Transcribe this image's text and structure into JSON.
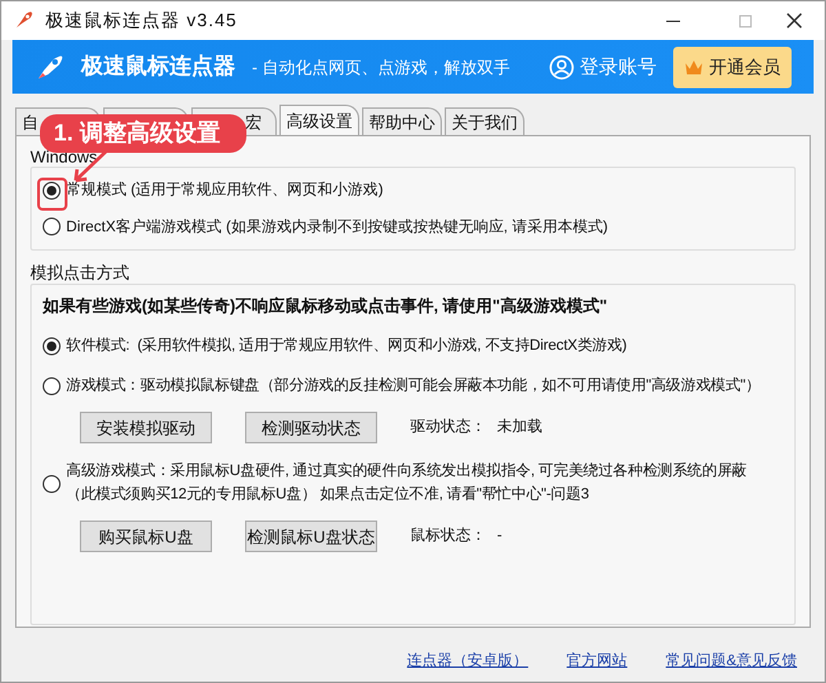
{
  "window": {
    "title": "极速鼠标连点器 v3.45"
  },
  "header": {
    "app_name": "极速鼠标连点器",
    "slogan": "- 自动化点网页、点游戏，解放双手",
    "login": "登录账号",
    "vip_button": "开通会员"
  },
  "tabs": [
    {
      "label": "自",
      "selected": false
    },
    {
      "selected": false
    },
    {
      "label": "宏",
      "selected": false
    },
    {
      "label": "高级设置",
      "selected": true
    },
    {
      "label": "帮助中心",
      "selected": false
    },
    {
      "label": "关于我们",
      "selected": false
    }
  ],
  "callout": {
    "text": "1. 调整高级设置"
  },
  "listen_group": {
    "title": "Windows",
    "options": [
      {
        "label": "常规模式 (适用于常规应用软件、网页和小游戏)",
        "selected": true
      },
      {
        "label": "DirectX客户端游戏模式 (如果游戏内录制不到按键或按热键无响应, 请采用本模式)",
        "selected": false
      }
    ]
  },
  "click_group": {
    "title": "模拟点击方式",
    "notice": "如果有些游戏(如某些传奇)不响应鼠标移动或点击事件, 请使用\"高级游戏模式\"",
    "options": [
      {
        "lines": [
          "软件模式:  (采用软件模拟, 适用于常规应用软件、网页和小游戏, 不支持DirectX类游戏)"
        ],
        "selected": true
      },
      {
        "lines": [
          "游戏模式：驱动模拟鼠标键盘（部分游戏的反挂检测可能会屏蔽本功能，如不可用请使用\"高级游戏模式\"）"
        ],
        "selected": false,
        "buttons": [
          "安装模拟驱动",
          "检测驱动状态"
        ],
        "status_label": "驱动状态：",
        "status_value": "未加载"
      },
      {
        "lines": [
          "高级游戏模式：采用鼠标U盘硬件, 通过真实的硬件向系统发出模拟指令, 可完美绕过各种检测系统的屏蔽",
          "（此模式须购买12元的专用鼠标U盘） 如果点击定位不准, 请看\"帮忙中心\"-问题3"
        ],
        "selected": false,
        "buttons": [
          "购买鼠标U盘",
          "检测鼠标U盘状态"
        ],
        "status_label": "鼠标状态：",
        "status_value": "-"
      }
    ]
  },
  "footer_links": [
    "连点器（安卓版）",
    "官方网站",
    "常见问题&意见反馈"
  ]
}
